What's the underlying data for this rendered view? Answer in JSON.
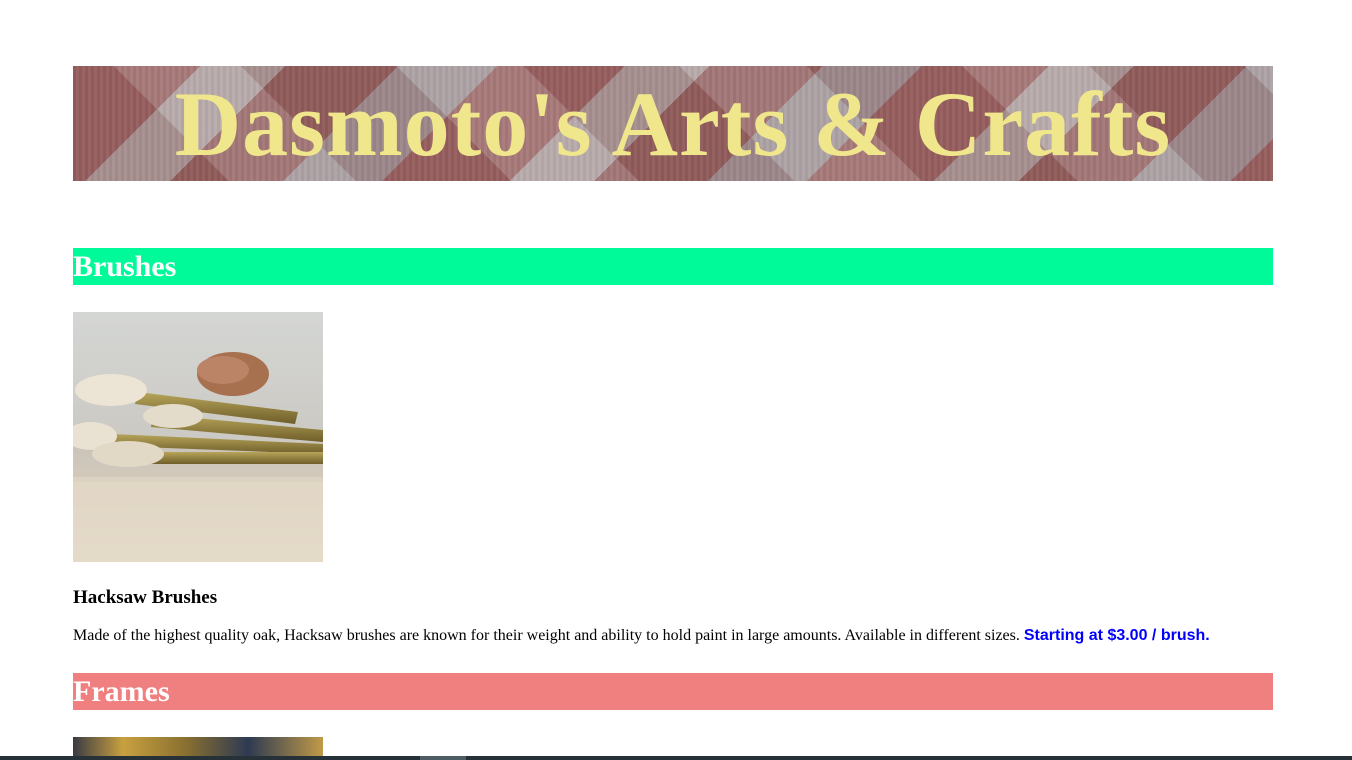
{
  "header": {
    "title": "Dasmoto's Arts & Crafts"
  },
  "sections": {
    "brushes": {
      "heading": "Brushes",
      "color": "#00fa9a",
      "product": {
        "image": "paint-brushes-photo",
        "title": "Hacksaw Brushes",
        "description": "Made of the highest quality oak, Hacksaw brushes are known for their weight and ability to hold paint in large amounts. Available in different sizes.",
        "price": "Starting at $3.00 / brush."
      }
    },
    "frames": {
      "heading": "Frames",
      "color": "#f08080",
      "product": {
        "image": "picture-frames-photo"
      }
    }
  },
  "colors": {
    "title_text": "#f0e68c",
    "price_text": "#0000ff",
    "heading_text": "#ffffff"
  }
}
